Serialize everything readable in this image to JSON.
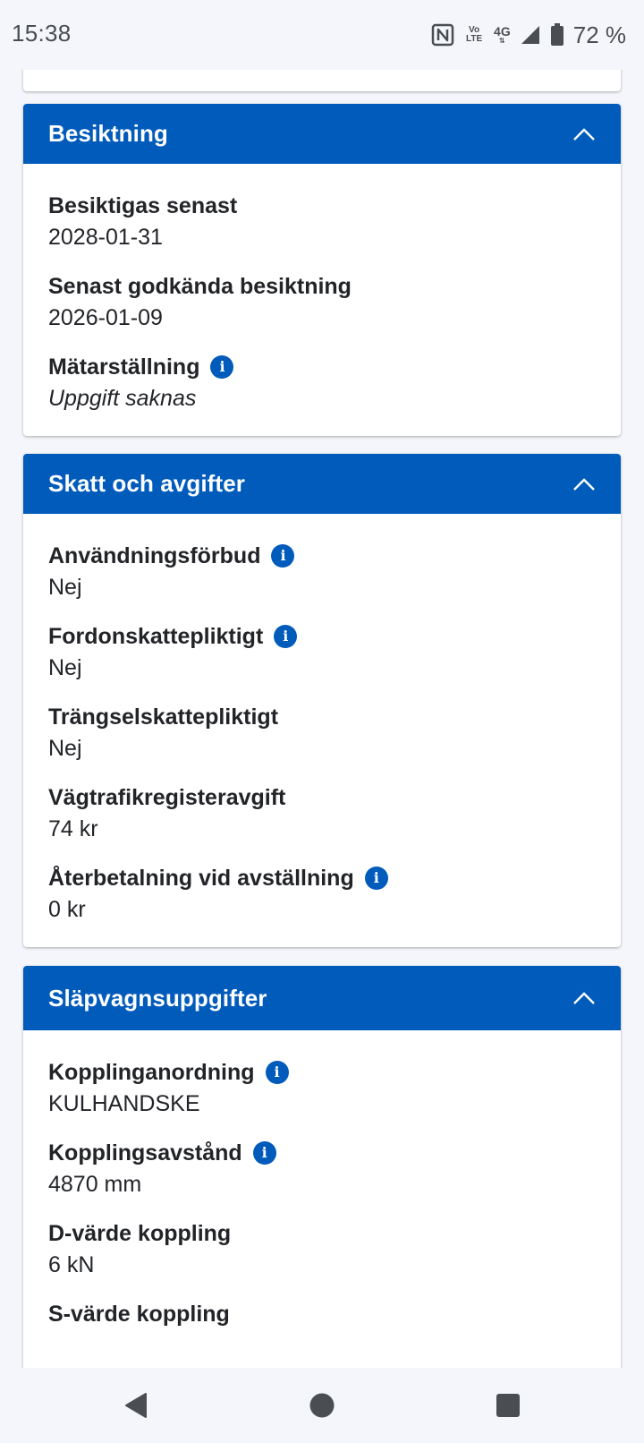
{
  "status_bar": {
    "time": "15:38",
    "volte_top": "Vo",
    "volte_bottom": "LTE",
    "network": "4G",
    "battery": "72 %"
  },
  "sections": {
    "inspection": {
      "title": "Besiktning",
      "fields": [
        {
          "label": "Besiktigas senast",
          "value": "2028-01-31"
        },
        {
          "label": "Senast godkända besiktning",
          "value": "2026-01-09"
        },
        {
          "label": "Mätarställning",
          "value": "Uppgift saknas"
        }
      ]
    },
    "tax": {
      "title": "Skatt och avgifter",
      "fields": [
        {
          "label": "Användningsförbud",
          "value": "Nej"
        },
        {
          "label": "Fordonskattepliktigt",
          "value": "Nej"
        },
        {
          "label": "Trängselskattepliktigt",
          "value": "Nej"
        },
        {
          "label": "Vägtrafikregisteravgift",
          "value": "74 kr"
        },
        {
          "label": "Återbetalning vid avställning",
          "value": "0 kr"
        }
      ]
    },
    "trailer": {
      "title": "Släpvagnsuppgifter",
      "fields": [
        {
          "label": "Kopplinganordning",
          "value": "KULHANDSKE"
        },
        {
          "label": "Kopplingsavstånd",
          "value": "4870 mm"
        },
        {
          "label": "D-värde koppling",
          "value": "6 kN"
        },
        {
          "label": "S-värde koppling",
          "value": ""
        }
      ]
    }
  },
  "icons": {
    "info": "i",
    "chevron": "chevron-up-icon"
  },
  "colors": {
    "accent": "#005bbb",
    "background": "#f4f6fb",
    "text": "#222428"
  }
}
